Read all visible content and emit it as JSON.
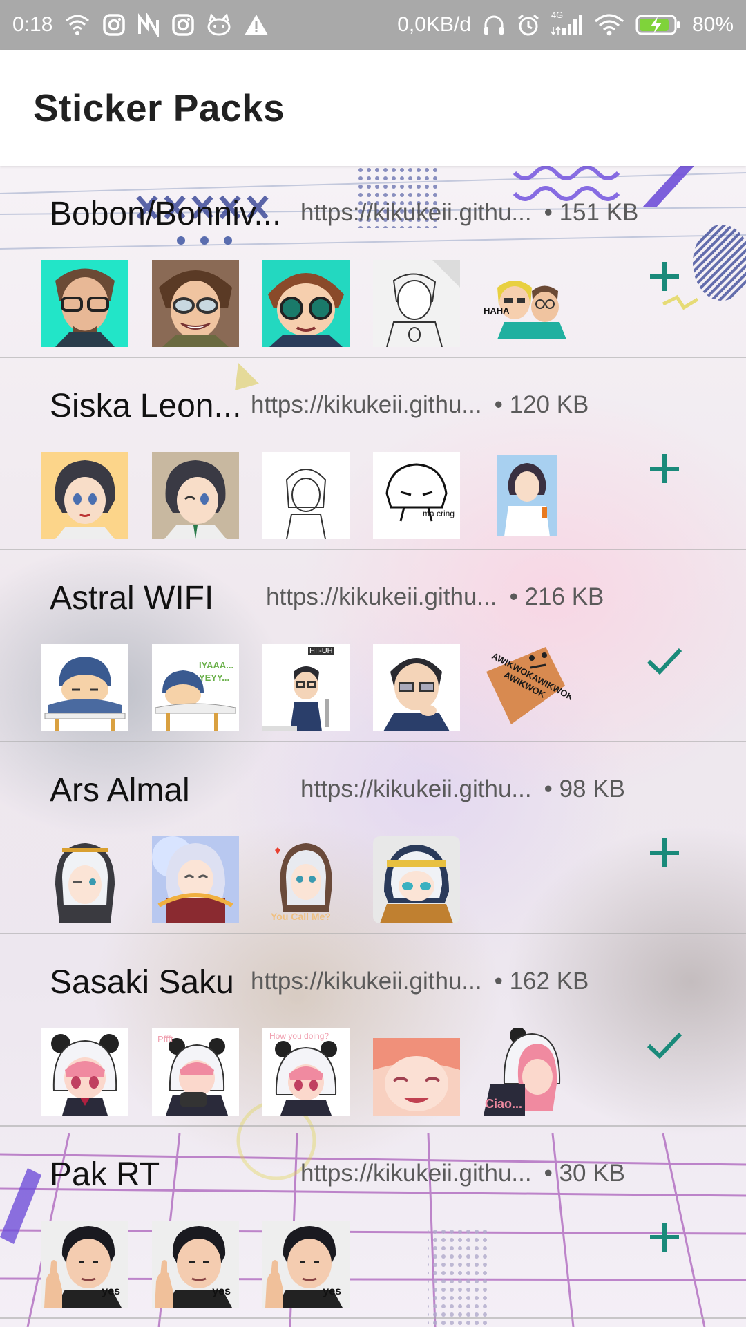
{
  "status_bar": {
    "time": "0:18",
    "net_speed": "0,0KB/d",
    "battery": "80%",
    "network_type": "4G",
    "icons_left": [
      "wifi-calling-icon",
      "instagram-icon",
      "n-app-icon",
      "instagram-icon",
      "cat-app-icon",
      "warning-icon"
    ],
    "icons_right": [
      "headphones-icon",
      "alarm-icon",
      "signal-icon",
      "wifi-icon",
      "battery-charging-icon"
    ]
  },
  "app_bar": {
    "title": "Sticker Packs"
  },
  "colors": {
    "accent": "#1a8a7a",
    "divider": "#aaaaaa"
  },
  "packs": [
    {
      "name": "Bobon/Bonniv...",
      "url": "https://kikukeii.githu...",
      "size": "• 151 KB",
      "action": "add-icon",
      "thumbs": [
        "sticker-glasses-man",
        "sticker-glasses-man-smile",
        "sticker-chibi-glasses",
        "sticker-sketch-man",
        "sticker-haha-duo"
      ],
      "thumb_texts": [
        "",
        "",
        "",
        "",
        "HAHA"
      ]
    },
    {
      "name": "Siska Leon...",
      "url": "https://kikukeii.githu...",
      "size": "• 120 KB",
      "action": "add-icon",
      "thumbs": [
        "sticker-dark-hair-girl",
        "sticker-dark-hair-girl-wink",
        "sticker-sketch-girl",
        "sticker-doodle-girl",
        "sticker-girl-photo"
      ],
      "thumb_texts": [
        "",
        "",
        "",
        "ma cring",
        ""
      ]
    },
    {
      "name": "Astral WIFI",
      "url": "https://kikukeii.githu...",
      "size": "• 216 KB",
      "action": "check-icon",
      "thumbs": [
        "sticker-sleepy-beanie",
        "sticker-beanie-yeyy",
        "sticker-glasses-boy-hii",
        "sticker-thinking-man",
        "sticker-awikwok"
      ],
      "thumb_texts": [
        "",
        "IYAAA... YEYY...",
        "HII-UH",
        "",
        "AWIKWOKAWIKWOK AWIKWOK"
      ]
    },
    {
      "name": "Ars Almal",
      "url": "https://kikukeii.githu...",
      "size": "• 98 KB",
      "action": "add-icon",
      "thumbs": [
        "sticker-white-hair-hood",
        "sticker-magic-girl",
        "sticker-you-call-me",
        "sticker-chibi-hood"
      ],
      "thumb_texts": [
        "",
        "",
        "You Call Me?",
        ""
      ]
    },
    {
      "name": "Sasaki Saku",
      "url": "https://kikukeii.githu...",
      "size": "• 162 KB",
      "action": "check-icon",
      "thumbs": [
        "sticker-panda-hood-girl",
        "sticker-panda-gamer",
        "sticker-how-you-doing",
        "sticker-pink-smile",
        "sticker-ciao"
      ],
      "thumb_texts": [
        "",
        "Pffft",
        "How you doing?",
        "",
        "Ciao..."
      ]
    },
    {
      "name": "Pak RT",
      "url": "https://kikukeii.githu...",
      "size": "• 30 KB",
      "action": "add-icon",
      "thumbs": [
        "sticker-thumbs-up-yes",
        "sticker-thumbs-up-yes",
        "sticker-thumbs-up-yes"
      ],
      "thumb_texts": [
        "yes",
        "yes",
        "yes"
      ]
    }
  ]
}
